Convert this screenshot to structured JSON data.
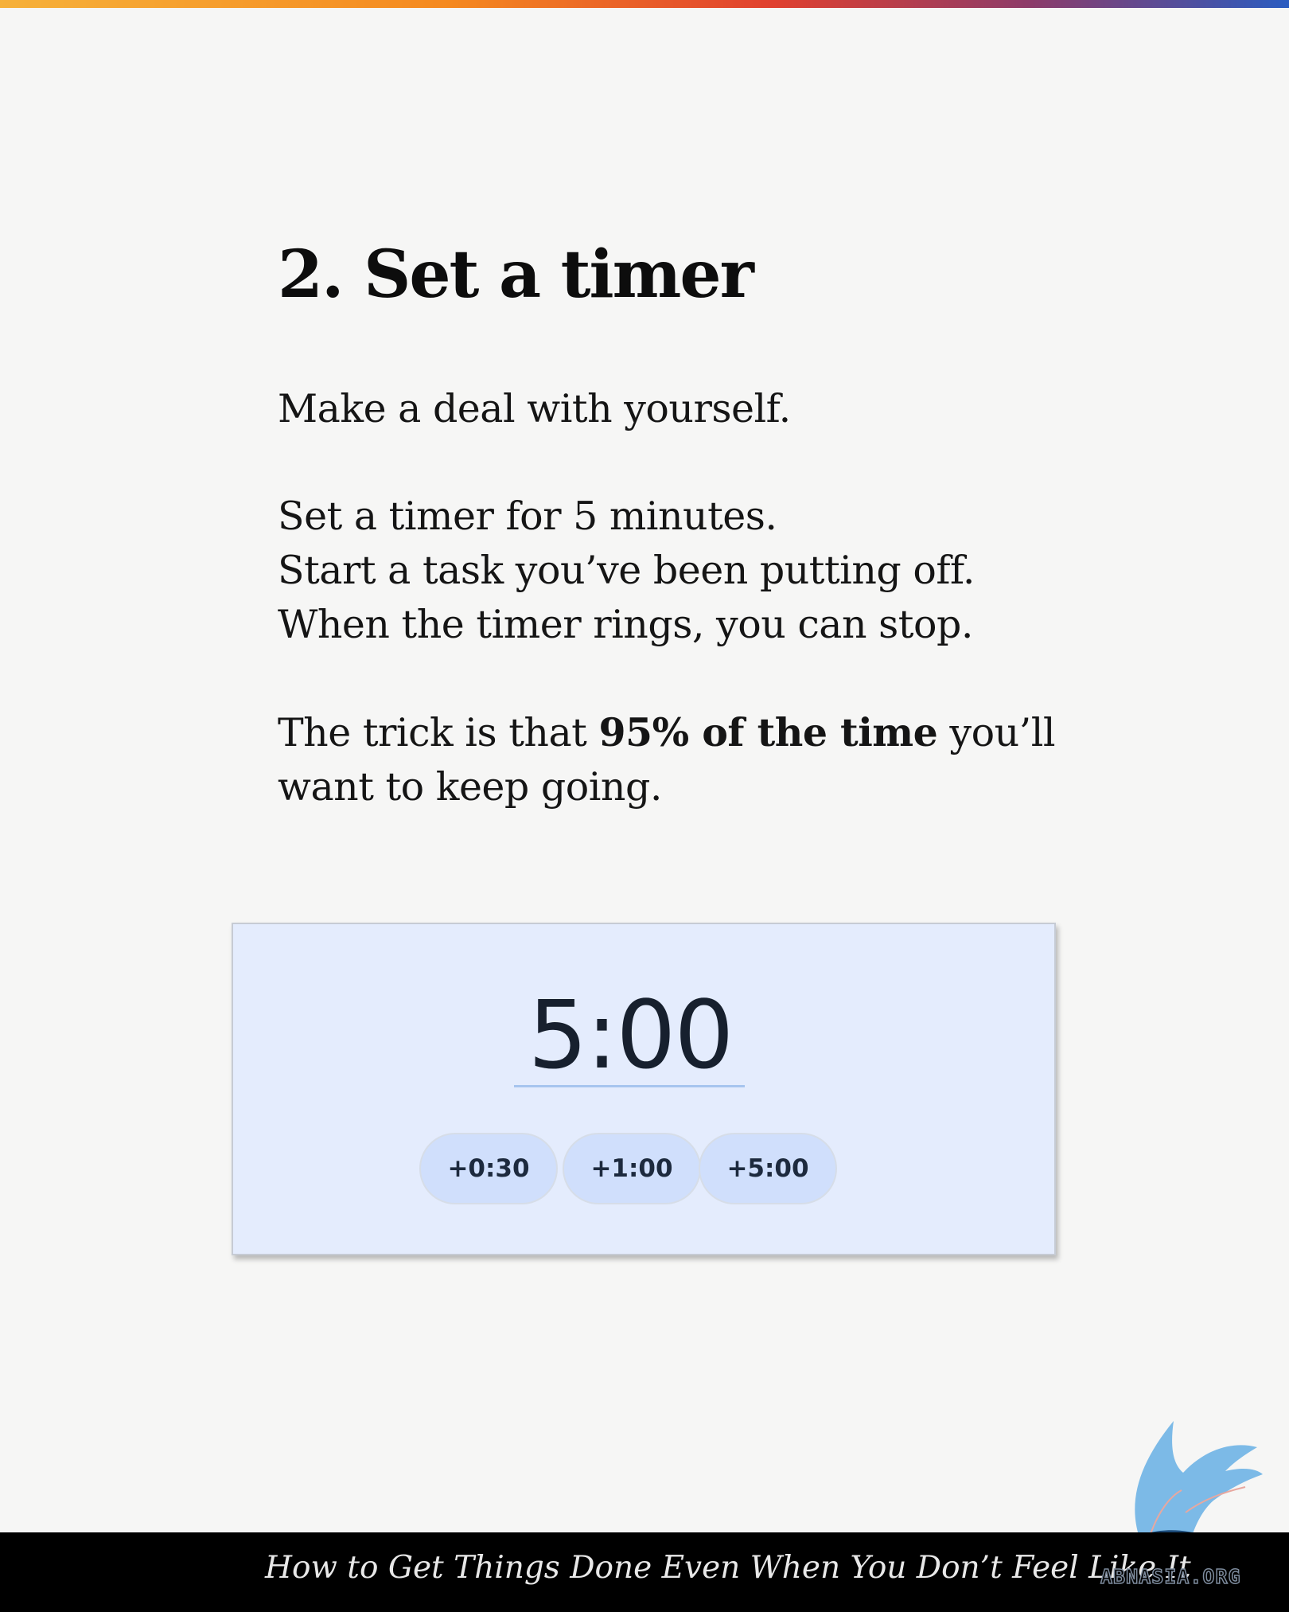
{
  "heading": "2. Set a timer",
  "paragraphs": {
    "p1": "Make a deal with yourself.",
    "p2": {
      "line1": "Set a timer for 5 minutes.",
      "line2": "Start a task you’ve been putting off.",
      "line3": "When the timer rings, you can stop."
    },
    "p3": {
      "lead": "The trick is that ",
      "bold": "95% of the time",
      "tail": " you’ll",
      "line2": "want to keep going."
    }
  },
  "timer": {
    "value": "5:00",
    "chips": [
      "+0:30",
      "+1:00",
      "+5:00"
    ]
  },
  "footer": {
    "title": "How to Get Things Done Even When You Don’t Feel Like It",
    "brand": "ABNASIA.ORG"
  },
  "colors": {
    "background": "#f6f6f5",
    "card": "#e4ecfd",
    "chip": "#d0dffc",
    "footer": "#000000",
    "logo": "#6fb4e6"
  },
  "icons": {
    "logo": "winged-griffin-logo-icon"
  }
}
